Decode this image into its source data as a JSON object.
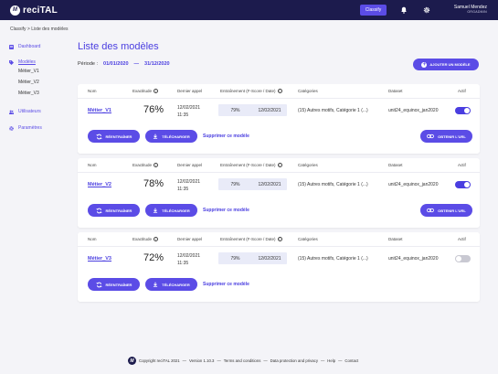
{
  "app": {
    "logo_text": "reciTAL",
    "logo_mark": "M",
    "classify_label": "Classify"
  },
  "user": {
    "name": "Samuel Mendez",
    "org": "ORGADMIN"
  },
  "breadcrumb": "Classify > Liste des modèles",
  "sidebar": {
    "dashboard": "Dashboard",
    "models": "Modèles",
    "sub_items": [
      "Métier_V1",
      "Métier_V2",
      "Métier_V3"
    ],
    "users": "Utilisateurs",
    "settings": "Paramètres"
  },
  "page": {
    "title": "Liste des modèles",
    "period_label": "Période :",
    "period_from": "01/01/2020",
    "period_sep": "—",
    "period_to": "31/12/2020",
    "add_label": "AJOUTER UN MODÈLE"
  },
  "headers": {
    "name": "Nom",
    "exactitude": "Exactitude",
    "last_call": "Dernier appel",
    "training": "Entraînement (F-Score / Date)",
    "categories": "Catégories",
    "dataset": "Dataset",
    "active": "Actif"
  },
  "actions": {
    "retrain": "RÉENTRAÎNER",
    "download": "TÉLÉCHARGER",
    "delete": "Supprimer ce modèle",
    "get_url": "OBTENIR L'URL"
  },
  "models": [
    {
      "name": "Métier_V1",
      "exactitude": "76%",
      "last_call_date": "12/02/2021",
      "last_call_time": "11:35",
      "fscore": "79%",
      "train_date": "12/02/2021",
      "categories": "(15) Autres motifs, Catégorie 1 (...)",
      "dataset": "unit24_equinox_jan2020",
      "active": true,
      "has_url": true
    },
    {
      "name": "Métier_V2",
      "exactitude": "78%",
      "last_call_date": "12/02/2021",
      "last_call_time": "11:35",
      "fscore": "79%",
      "train_date": "12/02/2021",
      "categories": "(15) Autres motifs, Catégorie 1 (...)",
      "dataset": "unit24_equinox_jan2020",
      "active": true,
      "has_url": true
    },
    {
      "name": "Métier_V3",
      "exactitude": "72%",
      "last_call_date": "12/02/2021",
      "last_call_time": "11:35",
      "fscore": "79%",
      "train_date": "12/02/2021",
      "categories": "(15) Autres motifs, Catégorie 1 (...)",
      "dataset": "unit24_equinox_jan2020",
      "active": false,
      "has_url": false
    }
  ],
  "footer": {
    "copyright": "Copyright reciTAL 2021",
    "version": "Version 1.10.3",
    "terms": "Terms and conditions",
    "privacy": "Data protection and privacy",
    "help": "Help",
    "contact": "Contact",
    "sep": "—"
  },
  "colors": {
    "accent": "#5b4ce6",
    "topbar": "#1c1b4d",
    "toggle_on": "#4a3ee0",
    "toggle_off": "#c9c9d2"
  },
  "icons": {
    "bell": "bell-icon",
    "gear": "gear-icon",
    "sync": "sync-icon",
    "download": "download-icon",
    "link": "link-icon",
    "info": "info-icon"
  }
}
